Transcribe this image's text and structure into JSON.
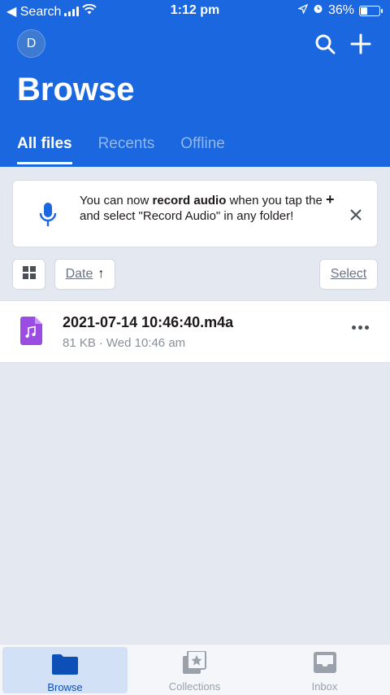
{
  "status_bar": {
    "back_label": "◀ Search",
    "time": "1:12 pm",
    "battery_percent": "36%",
    "battery_level": 0.36
  },
  "header": {
    "avatar_initial": "D",
    "title": "Browse",
    "tabs": [
      {
        "label": "All files",
        "active": true
      },
      {
        "label": "Recents",
        "active": false
      },
      {
        "label": "Offline",
        "active": false
      }
    ]
  },
  "notice": {
    "text_before": "You can now ",
    "text_bold": "record audio",
    "text_mid": " when you tap the ",
    "plus_symbol": "+",
    "text_after": " and select \"Record Audio\" in any folder!"
  },
  "toolbar": {
    "sort_label": "Date",
    "sort_arrow": "↑",
    "select_label": "Select"
  },
  "files": [
    {
      "name": "2021-07-14 10:46:40.m4a",
      "size": "81 KB",
      "separator": "·",
      "modified": "Wed 10:46 am",
      "icon": "audio-file-icon"
    }
  ],
  "bottom_nav": {
    "items": [
      {
        "label": "Browse",
        "icon": "folder-icon",
        "active": true
      },
      {
        "label": "Collections",
        "icon": "collections-icon",
        "active": false
      },
      {
        "label": "Inbox",
        "icon": "inbox-icon",
        "active": false
      }
    ]
  },
  "colors": {
    "brand_blue": "#1a67e0",
    "audio_icon_purple": "#9b4de3"
  }
}
